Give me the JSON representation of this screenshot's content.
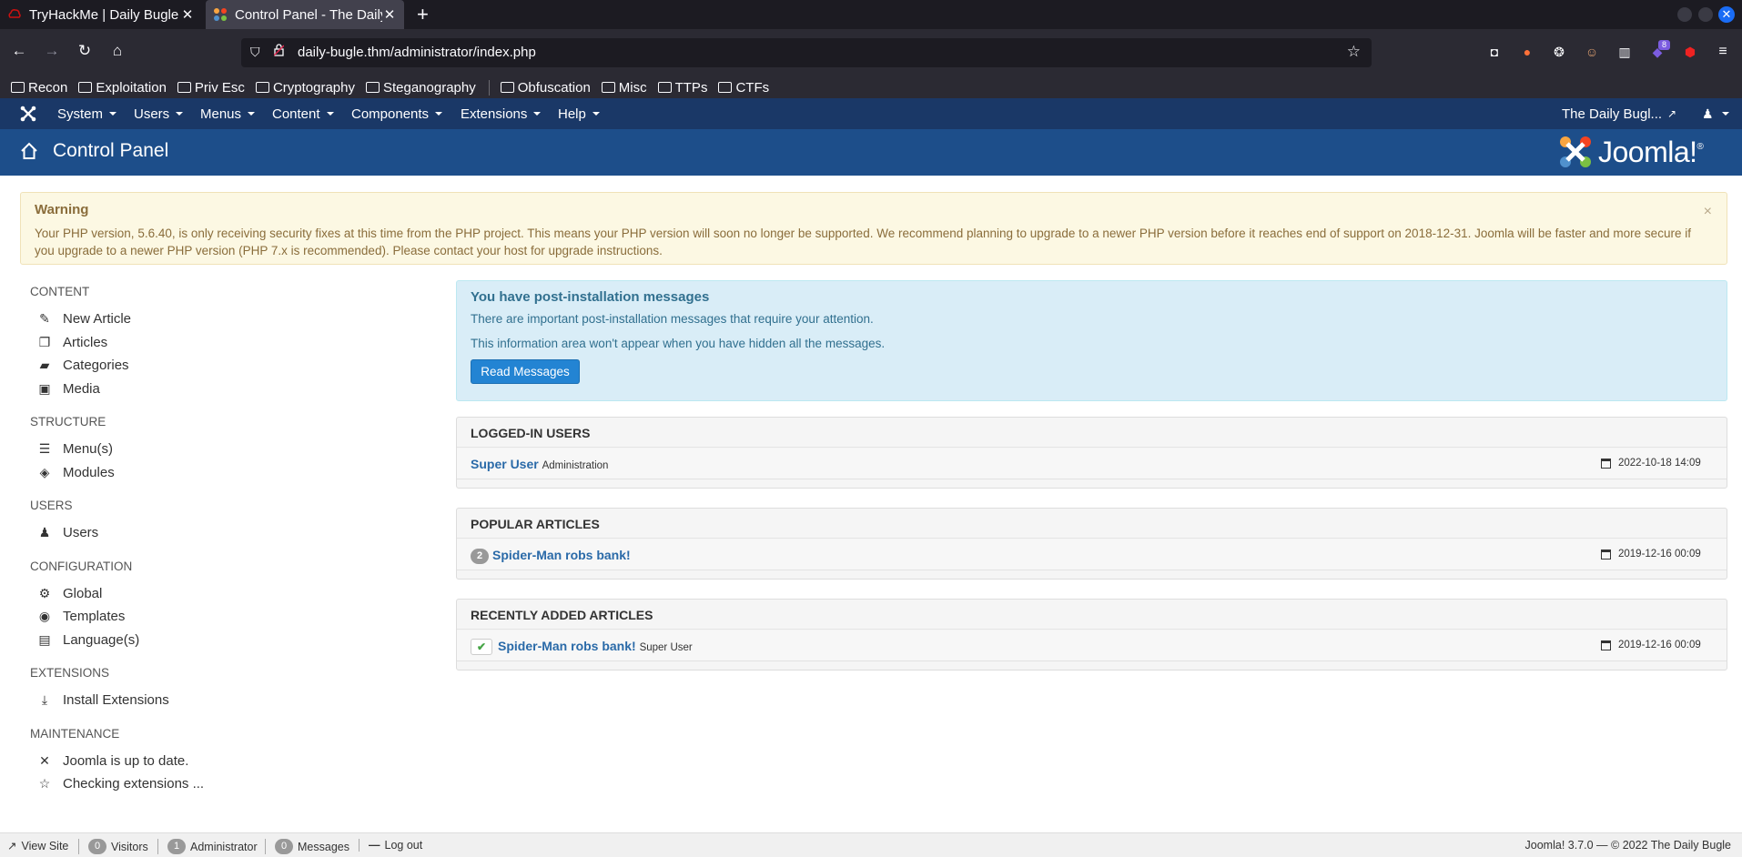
{
  "browser": {
    "tabs": [
      {
        "title": "TryHackMe | Daily Bugle",
        "close": "✕"
      },
      {
        "title": "Control Panel - The Daily B",
        "close": "✕"
      }
    ],
    "new_tab": "+",
    "url": "daily-bugle.thm/administrator/index.php",
    "extension_badge": "8",
    "bookmarks": [
      "Recon",
      "Exploitation",
      "Priv Esc",
      "Cryptography",
      "Steganography",
      "Obfuscation",
      "Misc",
      "TTPs",
      "CTFs"
    ]
  },
  "jmenu": {
    "items": [
      "System",
      "Users",
      "Menus",
      "Content",
      "Components",
      "Extensions",
      "Help"
    ],
    "site_link": "The Daily Bugl..."
  },
  "header": {
    "title": "Control Panel",
    "brand": "Joomla!",
    "brand_mark": "®"
  },
  "warning": {
    "title": "Warning",
    "text": "Your PHP version, 5.6.40, is only receiving security fixes at this time from the PHP project. This means your PHP version will soon no longer be supported. We recommend planning to upgrade to a newer PHP version before it reaches end of support on 2018-12-31. Joomla will be faster and more secure if you upgrade to a newer PHP version (PHP 7.x is recommended). Please contact your host for upgrade instructions.",
    "close": "×"
  },
  "sidebar": {
    "content": {
      "heading": "CONTENT",
      "items": [
        "New Article",
        "Articles",
        "Categories",
        "Media"
      ]
    },
    "structure": {
      "heading": "STRUCTURE",
      "items": [
        "Menu(s)",
        "Modules"
      ]
    },
    "users": {
      "heading": "USERS",
      "items": [
        "Users"
      ]
    },
    "configuration": {
      "heading": "CONFIGURATION",
      "items": [
        "Global",
        "Templates",
        "Language(s)"
      ]
    },
    "extensions": {
      "heading": "EXTENSIONS",
      "items": [
        "Install Extensions"
      ]
    },
    "maintenance": {
      "heading": "MAINTENANCE",
      "items": [
        "Joomla is up to date.",
        "Checking extensions ..."
      ]
    }
  },
  "postinstall": {
    "title": "You have post-installation messages",
    "line1": "There are important post-installation messages that require your attention.",
    "line2": "This information area won't appear when you have hidden all the messages.",
    "button": "Read Messages"
  },
  "logged_in": {
    "heading": "LOGGED-IN USERS",
    "user": "Super User",
    "role": "Administration",
    "date": "2022-10-18 14:09"
  },
  "popular": {
    "heading": "POPULAR ARTICLES",
    "hits": "2",
    "title": "Spider-Man robs bank!",
    "date": "2019-12-16 00:09"
  },
  "recent": {
    "heading": "RECENTLY ADDED ARTICLES",
    "title": "Spider-Man robs bank!",
    "author": "Super User",
    "date": "2019-12-16 00:09"
  },
  "statusbar": {
    "view_site": "View Site",
    "visitors_count": "0",
    "visitors": "Visitors",
    "admin_count": "1",
    "admin": "Administrator",
    "messages_count": "0",
    "messages": "Messages",
    "logout": "Log out",
    "version": "Joomla! 3.7.0 — © 2022 The Daily Bugle"
  }
}
